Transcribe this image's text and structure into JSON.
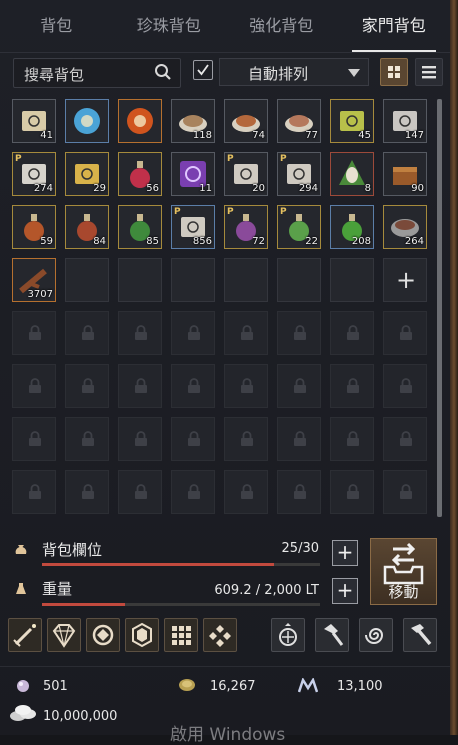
{
  "tabs": [
    {
      "label": "背包",
      "active": false
    },
    {
      "label": "珍珠背包",
      "active": false
    },
    {
      "label": "強化背包",
      "active": false
    },
    {
      "label": "家門背包",
      "active": true
    }
  ],
  "toolbar": {
    "search_placeholder": "搜尋背包",
    "sort_checked": true,
    "sort_label": "自動排列"
  },
  "inventory": {
    "items": [
      {
        "qty": "41",
        "p": false,
        "icon": "scroll-icon",
        "color": "#d8cba8"
      },
      {
        "qty": "",
        "p": false,
        "icon": "blue-orb-icon",
        "color": "#4aa3d6"
      },
      {
        "qty": "",
        "p": false,
        "icon": "red-orb-icon",
        "color": "#d0541e"
      },
      {
        "qty": "118",
        "p": false,
        "icon": "food-plate-icon",
        "color": "#a8835e"
      },
      {
        "qty": "74",
        "p": false,
        "icon": "food-plate-icon",
        "color": "#b4683c"
      },
      {
        "qty": "77",
        "p": false,
        "icon": "food-plate-icon",
        "color": "#b5785c"
      },
      {
        "qty": "45",
        "p": false,
        "icon": "scroll-icon",
        "color": "#b8c04a"
      },
      {
        "qty": "147",
        "p": false,
        "icon": "scroll-icon",
        "color": "#c9c6c2"
      },
      {
        "qty": "274",
        "p": true,
        "icon": "scroll-icon",
        "color": "#d6d3cc"
      },
      {
        "qty": "29",
        "p": false,
        "icon": "scroll-icon",
        "color": "#d8b24a"
      },
      {
        "qty": "56",
        "p": false,
        "icon": "potion-icon",
        "color": "#c0304a"
      },
      {
        "qty": "11",
        "p": false,
        "icon": "purple-card-icon",
        "color": "#7a3fb0"
      },
      {
        "qty": "20",
        "p": true,
        "icon": "scroll-icon",
        "color": "#cfcac1"
      },
      {
        "qty": "294",
        "p": true,
        "icon": "scroll-icon",
        "color": "#cfcac1"
      },
      {
        "qty": "8",
        "p": false,
        "icon": "mask-icon",
        "color": "#4a8a3a"
      },
      {
        "qty": "90",
        "p": false,
        "icon": "chest-icon",
        "color": "#9a5a2a"
      },
      {
        "qty": "59",
        "p": false,
        "icon": "potion-icon",
        "color": "#b4562a"
      },
      {
        "qty": "84",
        "p": false,
        "icon": "potion-icon",
        "color": "#a8482e"
      },
      {
        "qty": "85",
        "p": false,
        "icon": "potion-icon",
        "color": "#3f8a3c"
      },
      {
        "qty": "856",
        "p": true,
        "icon": "scroll-icon",
        "color": "#cfcac1"
      },
      {
        "qty": "72",
        "p": true,
        "icon": "potion-icon",
        "color": "#8a4a9a"
      },
      {
        "qty": "22",
        "p": true,
        "icon": "potion-icon",
        "color": "#5aa04a"
      },
      {
        "qty": "208",
        "p": false,
        "icon": "potion-icon",
        "color": "#4aa03a"
      },
      {
        "qty": "264",
        "p": false,
        "icon": "bowl-icon",
        "color": "#9a9a9a"
      },
      {
        "qty": "3707",
        "p": false,
        "icon": "branch-icon",
        "color": "#8a4a2a"
      }
    ],
    "empty_slots": 6,
    "add_slot_label": "+",
    "locked_rows_partial": 1,
    "locked_full_rows": 4
  },
  "capacity": {
    "slots_label": "背包欄位",
    "slots_value": "25/30",
    "slots_fraction": 0.8333,
    "weight_label": "重量",
    "weight_value": "609.2 / 2,000 LT",
    "weight_fraction": 0.3,
    "move_label": "移動"
  },
  "currency": {
    "pearls": "501",
    "gold": "16,267",
    "mileage": "13,100",
    "silver": "10,000,000"
  },
  "watermark": "啟用 Windows"
}
